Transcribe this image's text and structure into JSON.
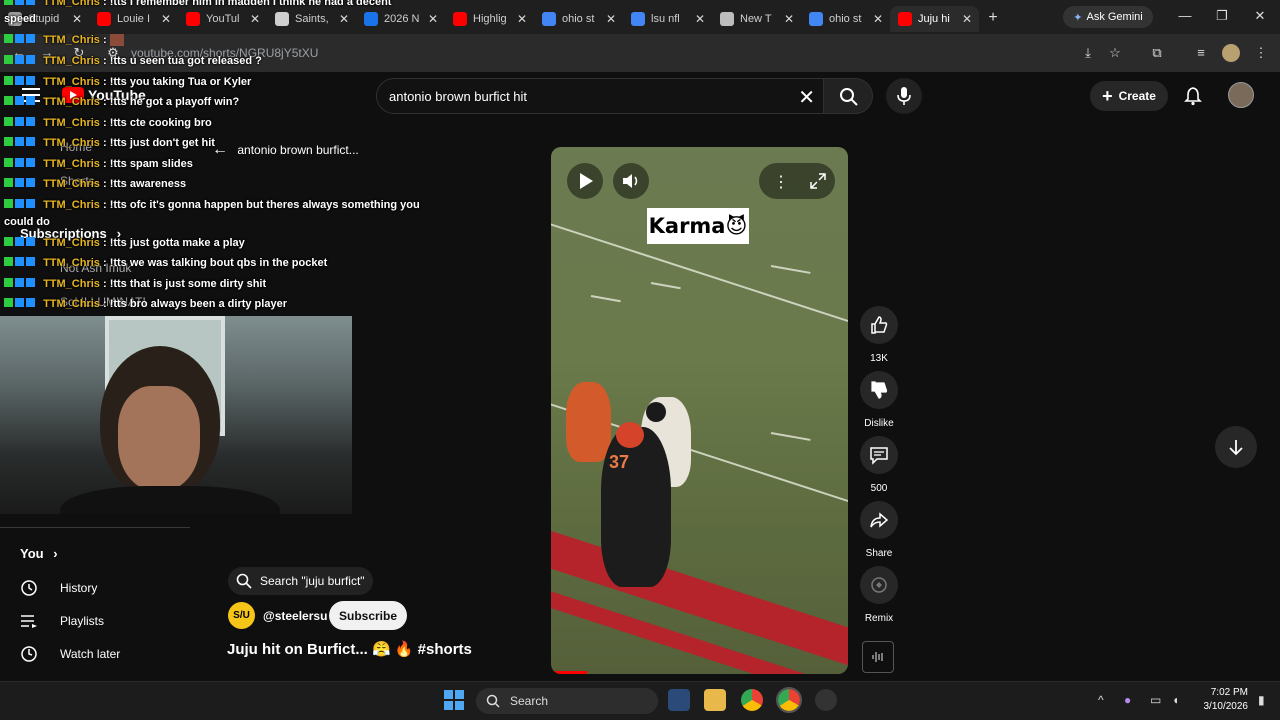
{
  "browser": {
    "tabs": [
      {
        "label": "Stupid",
        "favicon_color": "#9b9b9b"
      },
      {
        "label": "Louie I",
        "favicon_color": "#ff0000"
      },
      {
        "label": "YouTul",
        "favicon_color": "#ff0000"
      },
      {
        "label": "Saints,",
        "favicon_color": "#cfcfcf"
      },
      {
        "label": "2026 N",
        "favicon_color": "#1a73e8"
      },
      {
        "label": "Highlig",
        "favicon_color": "#ff0000"
      },
      {
        "label": "ohio st",
        "favicon_color": "#4285f4"
      },
      {
        "label": "lsu nfl",
        "favicon_color": "#4285f4"
      },
      {
        "label": "New T",
        "favicon_color": "#bdbdbd"
      },
      {
        "label": "ohio st",
        "favicon_color": "#4285f4"
      },
      {
        "label": "Juju hi",
        "favicon_color": "#ff0000",
        "active": true
      }
    ],
    "close_glyph": "✕",
    "new_tab_glyph": "+",
    "gemini_label": "Ask Gemini",
    "url": "youtube.com/shorts/NGRU8jY5tXU"
  },
  "youtube": {
    "logo_text": "YouTube",
    "search_query": "antonio brown burfict hit",
    "create_label": "Create",
    "sidebar": {
      "back_label": "antonio brown burfict...",
      "home": "Home",
      "shorts": "Shorts",
      "subscriptions": "Subscriptions",
      "sub_item1": "Not Ash Imuk",
      "sub_item2": "Sol ILLUMINATI",
      "you": "You",
      "history": "History",
      "playlists": "Playlists",
      "watch_later": "Watch later"
    },
    "short": {
      "search_chip": "Search \"juju burfict\"",
      "channel_initials": "S/U",
      "channel": "@steelersu",
      "subscribe_label": "Subscribe",
      "title": "Juju hit on Burfict... 😤 🔥 #shorts",
      "overlay_text": "Karma😈",
      "progress_pct": 12
    },
    "actions": {
      "like_count": "13K",
      "dislike_label": "Dislike",
      "comment_count": "500",
      "share_label": "Share",
      "remix_label": "Remix"
    }
  },
  "chat": {
    "speed_label": "speed",
    "messages": [
      {
        "user": "TTM_Chris",
        "text": "!tts I remember him in madden I think he had a decent"
      },
      {
        "user": "TTM_Chris",
        "text": ""
      },
      {
        "user": "TTM_Chris",
        "text": "!tts u seen tua got released ?"
      },
      {
        "user": "TTM_Chris",
        "text": "!tts you taking Tua or Kyler"
      },
      {
        "user": "TTM_Chris",
        "text": "!tts he got a playoff win?"
      },
      {
        "user": "TTM_Chris",
        "text": "!tts cte cooking bro"
      },
      {
        "user": "TTM_Chris",
        "text": "!tts just don't get hit"
      },
      {
        "user": "TTM_Chris",
        "text": "!tts spam slides"
      },
      {
        "user": "TTM_Chris",
        "text": "!tts awareness"
      },
      {
        "user": "TTM_Chris",
        "text": "!tts ofc it's gonna happen but theres always something you"
      },
      {
        "user": "TTM_Chris",
        "text": "!tts just gotta make a play"
      },
      {
        "user": "TTM_Chris",
        "text": "!tts we was talking bout qbs in the pocket"
      },
      {
        "user": "TTM_Chris",
        "text": "!tts that is just some dirty shit"
      },
      {
        "user": "TTM_Chris",
        "text": "!tts bro always been a dirty player"
      }
    ],
    "wrap_text": "could do",
    "separator": " : "
  },
  "taskbar": {
    "search_label": "Search",
    "time": "7:02 PM",
    "date": "3/10/2026"
  },
  "colors": {
    "accent_red": "#ff0000",
    "username_gold": "#e6b422",
    "background": "#0f0f0f"
  }
}
